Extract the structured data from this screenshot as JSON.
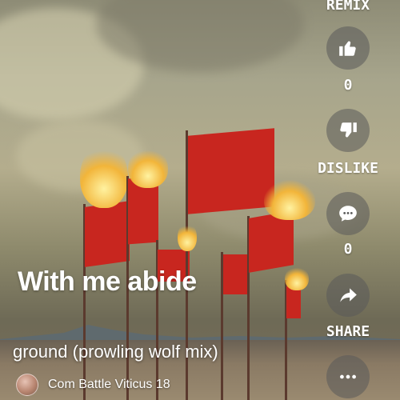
{
  "video": {
    "title": "With me abide",
    "subtitle": "ground (prowling wolf mix)"
  },
  "channel": {
    "name": "Com Battle Viticus 18"
  },
  "actions": {
    "remix_label": "REMIX",
    "like_count": "0",
    "dislike_label": "DISLIKE",
    "comment_count": "0",
    "share_label": "SHARE"
  },
  "icons": {
    "like": "thumbs-up-icon",
    "dislike": "thumbs-down-icon",
    "comment": "comment-icon",
    "share": "share-arrow-icon",
    "more": "more-horizontal-icon"
  },
  "colors": {
    "flag_red": "#c8261f",
    "button_bg": "rgba(90,90,90,0.55)",
    "text": "#ffffff"
  }
}
